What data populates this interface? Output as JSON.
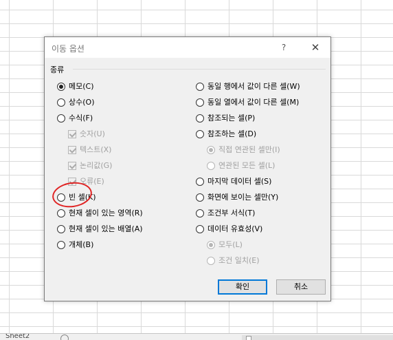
{
  "app": {
    "sheet_tab": "Sheet2"
  },
  "dialog": {
    "title": "이동 옵션",
    "help": "?",
    "close": "✕",
    "group_label": "종류",
    "left": {
      "memo": "메모(C)",
      "constants": "상수(O)",
      "formulas": "수식(F)",
      "numbers": "숫자(U)",
      "text": "텍스트(X)",
      "logicals": "논리값(G)",
      "errors": "오류(E)",
      "blanks": "빈 셀(K)",
      "current_region": "현재 셀이 있는 영역(R)",
      "current_array": "현재 셀이 있는 배열(A)",
      "objects": "개체(B)"
    },
    "right": {
      "row_diff": "동일 행에서 값이 다른 셀(W)",
      "col_diff": "동일 열에서 값이 다른 셀(M)",
      "precedents": "참조되는 셀(P)",
      "dependents": "참조하는 셀(D)",
      "direct_only": "직접 연관된 셀만(I)",
      "all_levels": "연관된 모든 셀(L)",
      "last_cell": "마지막 데이터 셀(S)",
      "visible_only": "화면에 보이는 셀만(Y)",
      "conditional_formats": "조건부 서식(T)",
      "data_validation": "데이터 유효성(V)",
      "dv_all": "모두(L)",
      "dv_same": "조건 일치(E)"
    },
    "ok_label": "확인",
    "cancel_label": "취소"
  },
  "colors": {
    "annotation": "#e02424",
    "default_button_border": "#0078d7"
  }
}
